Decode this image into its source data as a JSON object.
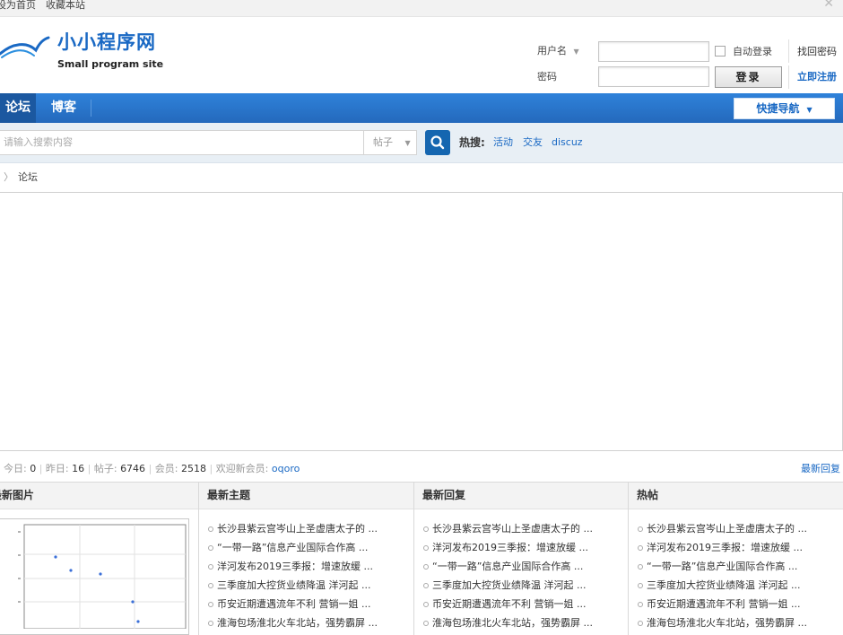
{
  "topbar": {
    "set_home": "设为首页",
    "bookmark": "收藏本站"
  },
  "logo": {
    "title": "小小程序网",
    "subtitle": "Small program site"
  },
  "login": {
    "username_label": "用户名",
    "password_label": "密码",
    "auto_login": "自动登录",
    "login_button": "登录",
    "find_password": "找回密码",
    "register": "立即注册"
  },
  "nav": {
    "items": [
      "论坛",
      "博客"
    ],
    "quick_nav": "快捷导航"
  },
  "search": {
    "placeholder": "请输入搜索内容",
    "type": "帖子",
    "hot_label": "热搜:",
    "hot_items": [
      "活动",
      "交友",
      "discuz"
    ]
  },
  "breadcrumb": {
    "current": "论坛"
  },
  "stats": {
    "today_label": "今日:",
    "today": "0",
    "yesterday_label": "昨日:",
    "yesterday": "16",
    "posts_label": "帖子:",
    "posts": "6746",
    "members_label": "会员:",
    "members": "2518",
    "welcome_label": "欢迎新会员:",
    "new_member": "oqoro",
    "latest_replies_link": "最新回复"
  },
  "panels": {
    "pictures_title": "最新图片",
    "topics_title": "最新主题",
    "replies_title": "最新回复",
    "hot_title": "热帖",
    "topics": [
      "长沙县紫云宫岑山上圣虚唐太子的 ...",
      "“一带一路”信息产业国际合作高 ...",
      "洋河发布2019三季报：增速放缓 ...",
      "三季度加大控货业绩降温 洋河起 ...",
      "币安近期遭遇流年不利 营销一姐 ...",
      "淮海包场淮北火车北站，强势霸屏 ..."
    ],
    "replies": [
      "长沙县紫云宫岑山上圣虚唐太子的 ...",
      "洋河发布2019三季报：增速放缓 ...",
      "“一带一路”信息产业国际合作高 ...",
      "三季度加大控货业绩降温 洋河起 ...",
      "币安近期遭遇流年不利 营销一姐 ...",
      "淮海包场淮北火车北站，强势霸屏 ..."
    ],
    "hot": [
      "长沙县紫云宫岑山上圣虚唐太子的 ...",
      "洋河发布2019三季报：增速放缓 ...",
      "“一带一路”信息产业国际合作高 ...",
      "三季度加大控货业绩降温 洋河起 ...",
      "币安近期遭遇流年不利 营销一姐 ...",
      "淮海包场淮北火车北站，强势霸屏 ..."
    ]
  },
  "colors": {
    "brand_blue": "#2c7ad1",
    "link_blue": "#1a69c4",
    "search_bg": "#e8eff5"
  }
}
